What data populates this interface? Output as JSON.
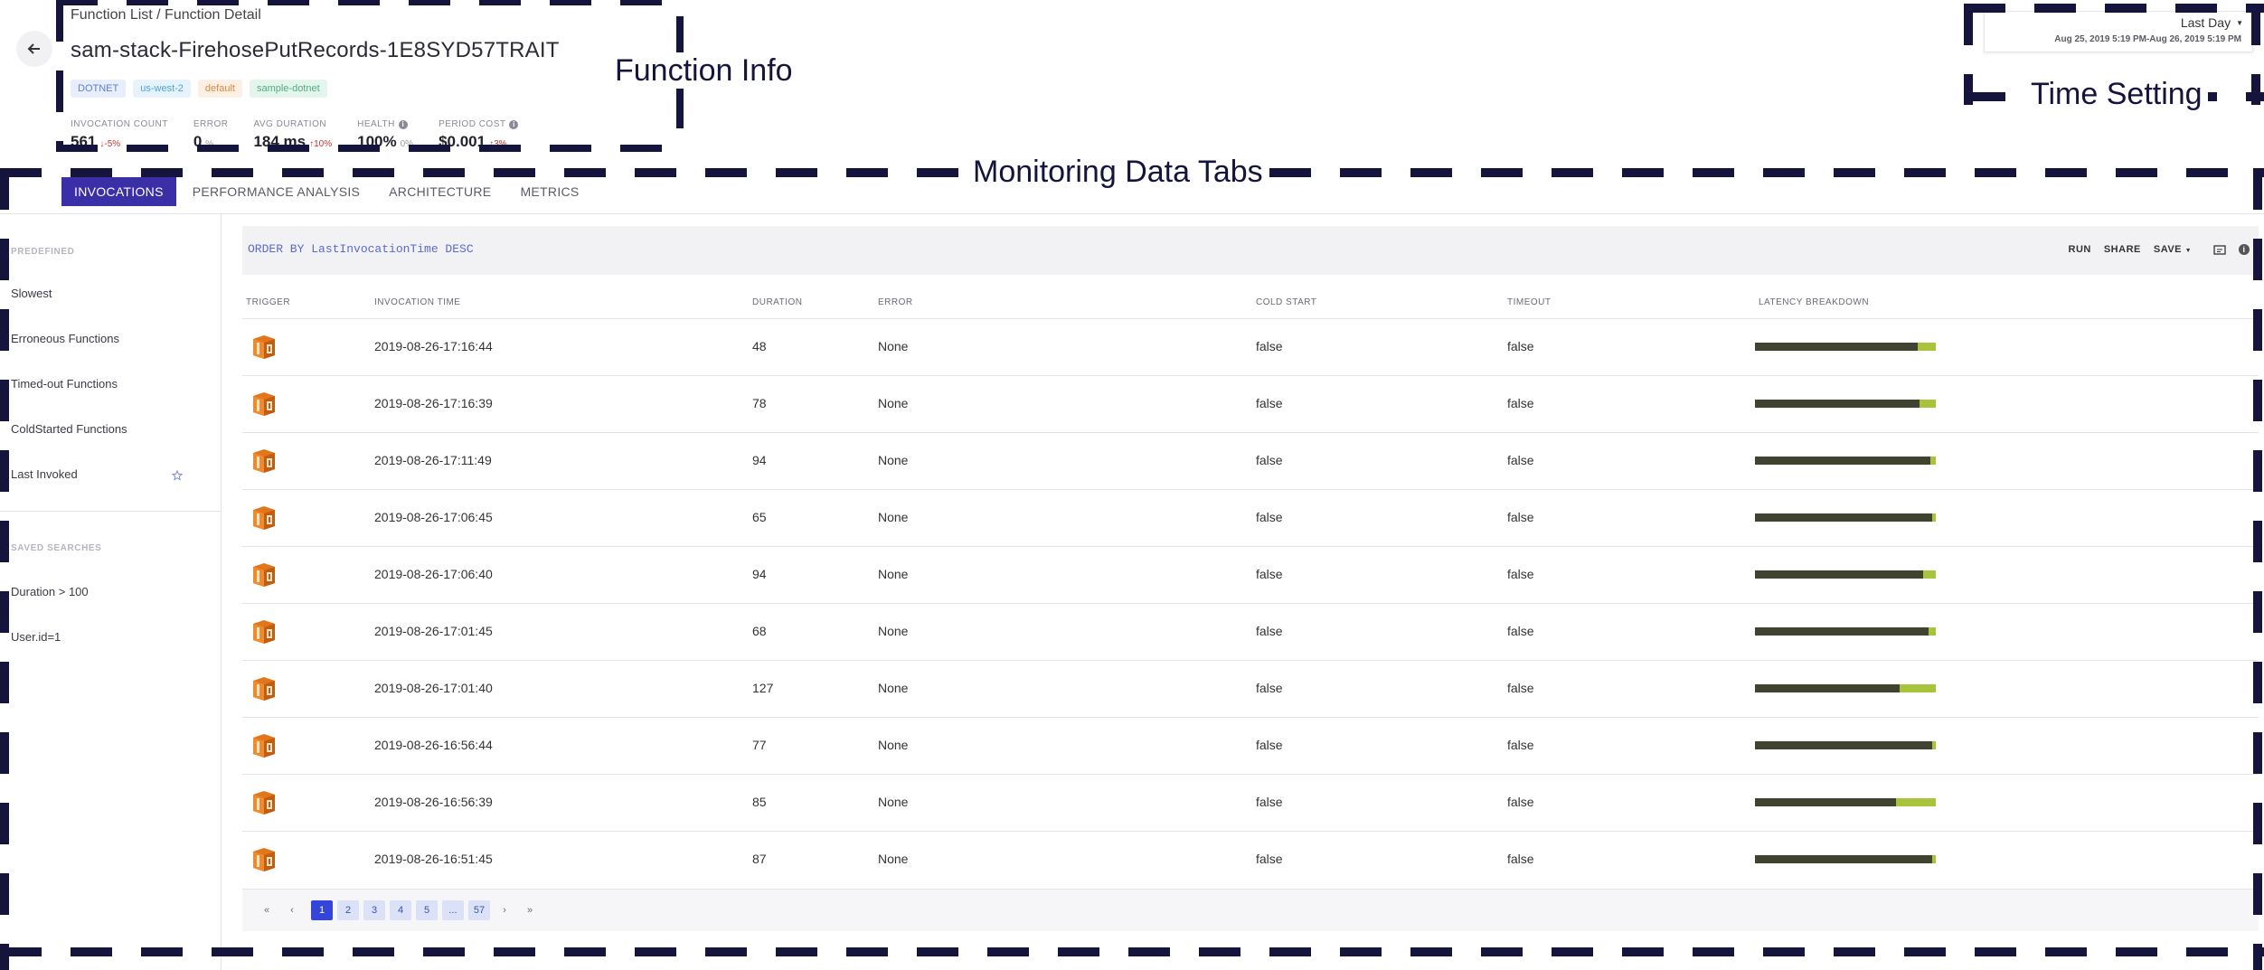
{
  "annotations": {
    "function_info": "Function Info",
    "time_setting": "Time Setting",
    "monitoring_tabs": "Monitoring Data Tabs"
  },
  "header": {
    "breadcrumb": "Function List / Function Detail",
    "title": "sam-stack-FirehosePutRecords-1E8SYD57TRAIT",
    "tags": [
      {
        "label": "DOTNET",
        "color": "#5b7fe0",
        "bg": "#e8eefc"
      },
      {
        "label": "us-west-2",
        "color": "#4aa3e0",
        "bg": "#e6f3fc"
      },
      {
        "label": "default",
        "color": "#e08a3c",
        "bg": "#fcefe3"
      },
      {
        "label": "sample-dotnet",
        "color": "#4fae7f",
        "bg": "#e3f5ec"
      }
    ],
    "stats": [
      {
        "label": "INVOCATION COUNT",
        "value": "561",
        "delta": "↓-5%",
        "delta_color": "#d0312d",
        "info": false
      },
      {
        "label": "ERROR",
        "value": "0",
        "delta": "%",
        "delta_color": "#9a9aa6",
        "info": false
      },
      {
        "label": "AVG DURATION",
        "value": "184 ms",
        "delta": "↑10%",
        "delta_color": "#d0312d",
        "info": false
      },
      {
        "label": "HEALTH",
        "value": "100%",
        "delta": "0%",
        "delta_color": "#9a9aa6",
        "info": true
      },
      {
        "label": "PERIOD COST",
        "value": "$0.001",
        "delta": "↑3%",
        "delta_color": "#d0312d",
        "info": true
      }
    ]
  },
  "time": {
    "range": "Last Day",
    "dates": "Aug 25, 2019 5:19 PM-Aug 26, 2019 5:19 PM"
  },
  "tabs": [
    {
      "label": "INVOCATIONS",
      "active": true
    },
    {
      "label": "PERFORMANCE ANALYSIS",
      "active": false
    },
    {
      "label": "ARCHITECTURE",
      "active": false
    },
    {
      "label": "METRICS",
      "active": false
    }
  ],
  "sidebar": {
    "predefined_label": "PREDEFINED",
    "predefined": [
      "Slowest",
      "Erroneous Functions",
      "Timed-out Functions",
      "ColdStarted Functions",
      "Last Invoked"
    ],
    "saved_label": "SAVED SEARCHES",
    "saved": [
      "Duration > 100",
      "User.id=1"
    ]
  },
  "query": {
    "text": "ORDER BY LastInvocationTime DESC",
    "run": "RUN",
    "share": "SHARE",
    "save": "SAVE"
  },
  "table": {
    "headers": [
      "TRIGGER",
      "INVOCATION TIME",
      "DURATION",
      "ERROR",
      "COLD START",
      "TIMEOUT",
      "LATENCY BREAKDOWN"
    ],
    "rows": [
      {
        "time": "2019-08-26-17:16:44",
        "duration": "48",
        "error": "None",
        "cold_start": "false",
        "timeout": "false",
        "latency_fraction": 0.9
      },
      {
        "time": "2019-08-26-17:16:39",
        "duration": "78",
        "error": "None",
        "cold_start": "false",
        "timeout": "false",
        "latency_fraction": 0.91
      },
      {
        "time": "2019-08-26-17:11:49",
        "duration": "94",
        "error": "None",
        "cold_start": "false",
        "timeout": "false",
        "latency_fraction": 0.97
      },
      {
        "time": "2019-08-26-17:06:45",
        "duration": "65",
        "error": "None",
        "cold_start": "false",
        "timeout": "false",
        "latency_fraction": 0.98
      },
      {
        "time": "2019-08-26-17:06:40",
        "duration": "94",
        "error": "None",
        "cold_start": "false",
        "timeout": "false",
        "latency_fraction": 0.93
      },
      {
        "time": "2019-08-26-17:01:45",
        "duration": "68",
        "error": "None",
        "cold_start": "false",
        "timeout": "false",
        "latency_fraction": 0.96
      },
      {
        "time": "2019-08-26-17:01:40",
        "duration": "127",
        "error": "None",
        "cold_start": "false",
        "timeout": "false",
        "latency_fraction": 0.8
      },
      {
        "time": "2019-08-26-16:56:44",
        "duration": "77",
        "error": "None",
        "cold_start": "false",
        "timeout": "false",
        "latency_fraction": 0.98
      },
      {
        "time": "2019-08-26-16:56:39",
        "duration": "85",
        "error": "None",
        "cold_start": "false",
        "timeout": "false",
        "latency_fraction": 0.78
      },
      {
        "time": "2019-08-26-16:51:45",
        "duration": "87",
        "error": "None",
        "cold_start": "false",
        "timeout": "false",
        "latency_fraction": 0.98
      }
    ],
    "trigger_icon": "aws-lambda-icon"
  },
  "pagination": {
    "first": "«",
    "prev": "‹",
    "pages": [
      "1",
      "2",
      "3",
      "4",
      "5",
      "...",
      "57"
    ],
    "current": "1",
    "next": "›",
    "last": "»"
  }
}
